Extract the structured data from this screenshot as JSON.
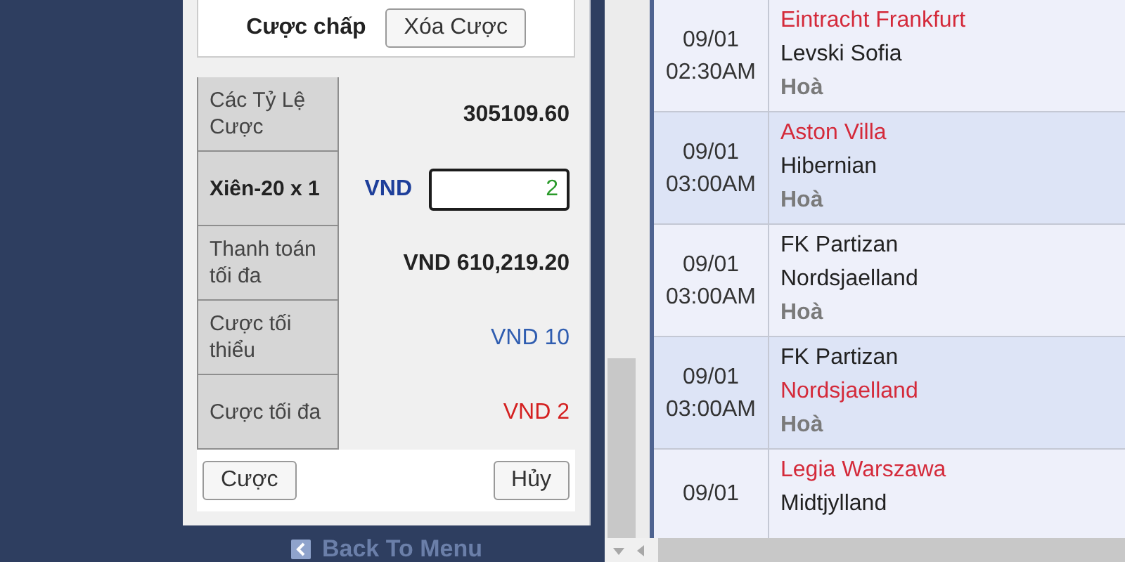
{
  "bet_slip": {
    "title": "Cược chấp",
    "clear_button": "Xóa Cược",
    "rows": [
      {
        "kind": "text",
        "label": "Các Tỷ Lệ Cược",
        "value": "305109.60",
        "color": "#222222",
        "emphasis": true
      },
      {
        "kind": "input",
        "label": "Xiên-20 x 1",
        "currency": "VND",
        "value": "2"
      },
      {
        "kind": "text",
        "label": "Thanh toán tối đa",
        "value": "VND 610,219.20",
        "color": "#222222",
        "emphasis": true
      },
      {
        "kind": "text",
        "label": "Cược tối thiểu",
        "value": "VND 10",
        "color": "#2f5db0",
        "emphasis": false
      },
      {
        "kind": "text",
        "label": "Cược tối đa",
        "value": "VND 2",
        "color": "#d42020",
        "emphasis": false
      }
    ],
    "buttons": [
      "Cược",
      "Hủy"
    ]
  },
  "back_link": "Back To Menu",
  "matches": [
    {
      "date": "09/01",
      "time": "02:30AM",
      "home": {
        "name": "Eintracht Frankfurt",
        "favorite": true
      },
      "away": {
        "name": "Levski Sofia",
        "favorite": false
      },
      "draw": "Hoà"
    },
    {
      "date": "09/01",
      "time": "03:00AM",
      "home": {
        "name": "Aston Villa",
        "favorite": true
      },
      "away": {
        "name": "Hibernian",
        "favorite": false
      },
      "draw": "Hoà"
    },
    {
      "date": "09/01",
      "time": "03:00AM",
      "home": {
        "name": "FK Partizan",
        "favorite": false
      },
      "away": {
        "name": "Nordsjaelland",
        "favorite": false
      },
      "draw": "Hoà"
    },
    {
      "date": "09/01",
      "time": "03:00AM",
      "home": {
        "name": "FK Partizan",
        "favorite": false
      },
      "away": {
        "name": "Nordsjaelland",
        "favorite": true
      },
      "draw": "Hoà"
    },
    {
      "date": "09/01",
      "home": {
        "name": "Legia Warszawa",
        "favorite": true
      },
      "away": {
        "name": "Midtjylland",
        "favorite": false
      }
    }
  ]
}
